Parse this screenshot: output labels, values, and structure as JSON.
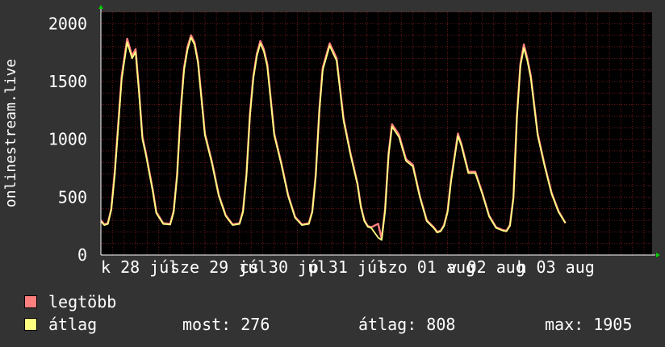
{
  "chart_data": {
    "type": "line",
    "ylabel": "onlinestream.live",
    "ylim": [
      0,
      2100
    ],
    "yticks": [
      0,
      500,
      1000,
      1500,
      2000
    ],
    "xlim": [
      0,
      7.95
    ],
    "xtick_labels": [
      "k 28 júl",
      "sze 29 júl",
      "cs 30 júl",
      "p 31 júl",
      "szo 01 aug",
      "v 02 aug",
      "h 03 aug"
    ],
    "xtick_positions": [
      0,
      1,
      2,
      3,
      4,
      5,
      6
    ],
    "grid": true,
    "colors": {
      "background": "#333333",
      "plot_background": "#000000",
      "grid": "#6a1a1a",
      "axes": "#ffffff",
      "arrow": "#00cc00",
      "max_line": "#ff7f7f",
      "avg_line": "#ffff80"
    },
    "series": [
      {
        "name": "legtöbb",
        "x": [
          0.0,
          0.05,
          0.1,
          0.15,
          0.2,
          0.3,
          0.38,
          0.45,
          0.5,
          0.55,
          0.6,
          0.65,
          0.7,
          0.75,
          0.8,
          0.9,
          1.0,
          1.05,
          1.1,
          1.15,
          1.2,
          1.25,
          1.3,
          1.35,
          1.4,
          1.5,
          1.6,
          1.7,
          1.8,
          1.9,
          2.0,
          2.05,
          2.1,
          2.15,
          2.2,
          2.25,
          2.3,
          2.35,
          2.4,
          2.5,
          2.6,
          2.7,
          2.8,
          2.9,
          3.0,
          3.05,
          3.1,
          3.15,
          3.2,
          3.3,
          3.4,
          3.5,
          3.6,
          3.7,
          3.75,
          3.8,
          3.85,
          3.9,
          4.0,
          4.05,
          4.1,
          4.15,
          4.2,
          4.3,
          4.4,
          4.5,
          4.6,
          4.7,
          4.8,
          4.85,
          4.9,
          4.95,
          5.0,
          5.05,
          5.1,
          5.15,
          5.2,
          5.3,
          5.4,
          5.5,
          5.6,
          5.7,
          5.8,
          5.85,
          5.9,
          5.95,
          6.0,
          6.05,
          6.1,
          6.15,
          6.2,
          6.3,
          6.4,
          6.5,
          6.6,
          6.7
        ],
        "values": [
          300,
          265,
          275,
          400,
          720,
          1550,
          1870,
          1720,
          1780,
          1420,
          1020,
          880,
          720,
          560,
          370,
          275,
          270,
          380,
          700,
          1250,
          1620,
          1800,
          1900,
          1840,
          1680,
          1050,
          810,
          520,
          345,
          265,
          275,
          380,
          700,
          1220,
          1550,
          1740,
          1850,
          1780,
          1650,
          1050,
          800,
          520,
          330,
          265,
          275,
          380,
          700,
          1250,
          1620,
          1830,
          1700,
          1180,
          880,
          620,
          420,
          300,
          250,
          240,
          270,
          140,
          400,
          880,
          1130,
          1040,
          830,
          780,
          510,
          300,
          240,
          200,
          210,
          260,
          380,
          650,
          850,
          1050,
          960,
          720,
          720,
          540,
          340,
          240,
          215,
          210,
          260,
          500,
          1200,
          1650,
          1820,
          1700,
          1550,
          1050,
          780,
          540,
          380,
          276
        ]
      },
      {
        "name": "átlag",
        "x": [
          0.0,
          0.05,
          0.1,
          0.15,
          0.2,
          0.3,
          0.38,
          0.45,
          0.5,
          0.55,
          0.6,
          0.65,
          0.7,
          0.75,
          0.8,
          0.9,
          1.0,
          1.05,
          1.1,
          1.15,
          1.2,
          1.25,
          1.3,
          1.35,
          1.4,
          1.5,
          1.6,
          1.7,
          1.8,
          1.9,
          2.0,
          2.05,
          2.1,
          2.15,
          2.2,
          2.25,
          2.3,
          2.35,
          2.4,
          2.5,
          2.6,
          2.7,
          2.8,
          2.9,
          3.0,
          3.05,
          3.1,
          3.15,
          3.2,
          3.3,
          3.4,
          3.5,
          3.6,
          3.7,
          3.75,
          3.8,
          3.85,
          3.9,
          4.0,
          4.05,
          4.1,
          4.15,
          4.2,
          4.3,
          4.4,
          4.5,
          4.6,
          4.7,
          4.8,
          4.85,
          4.9,
          4.95,
          5.0,
          5.05,
          5.1,
          5.15,
          5.2,
          5.3,
          5.4,
          5.5,
          5.6,
          5.7,
          5.8,
          5.85,
          5.9,
          5.95,
          6.0,
          6.05,
          6.1,
          6.15,
          6.2,
          6.3,
          6.4,
          6.5,
          6.6,
          6.7
        ],
        "values": [
          290,
          258,
          268,
          390,
          690,
          1520,
          1840,
          1700,
          1755,
          1400,
          1000,
          865,
          705,
          545,
          362,
          268,
          262,
          370,
          685,
          1225,
          1600,
          1775,
          1880,
          1820,
          1660,
          1035,
          795,
          510,
          338,
          258,
          268,
          370,
          685,
          1200,
          1530,
          1720,
          1830,
          1760,
          1630,
          1035,
          788,
          510,
          322,
          258,
          268,
          370,
          685,
          1230,
          1600,
          1810,
          1680,
          1160,
          865,
          610,
          412,
          292,
          244,
          234,
          150,
          130,
          380,
          860,
          1110,
          1020,
          815,
          765,
          500,
          292,
          234,
          195,
          204,
          252,
          370,
          635,
          835,
          1030,
          945,
          708,
          708,
          530,
          332,
          234,
          210,
          205,
          252,
          488,
          1180,
          1630,
          1790,
          1680,
          1530,
          1035,
          768,
          530,
          372,
          276
        ]
      }
    ]
  },
  "legend": {
    "items": [
      {
        "label": "legtöbb",
        "color": "#ff7f7f"
      },
      {
        "label": "átlag",
        "color": "#ffff80"
      }
    ],
    "stats": {
      "most": "most: 276",
      "atlag": "átlag: 808",
      "max": "max: 1905"
    }
  }
}
